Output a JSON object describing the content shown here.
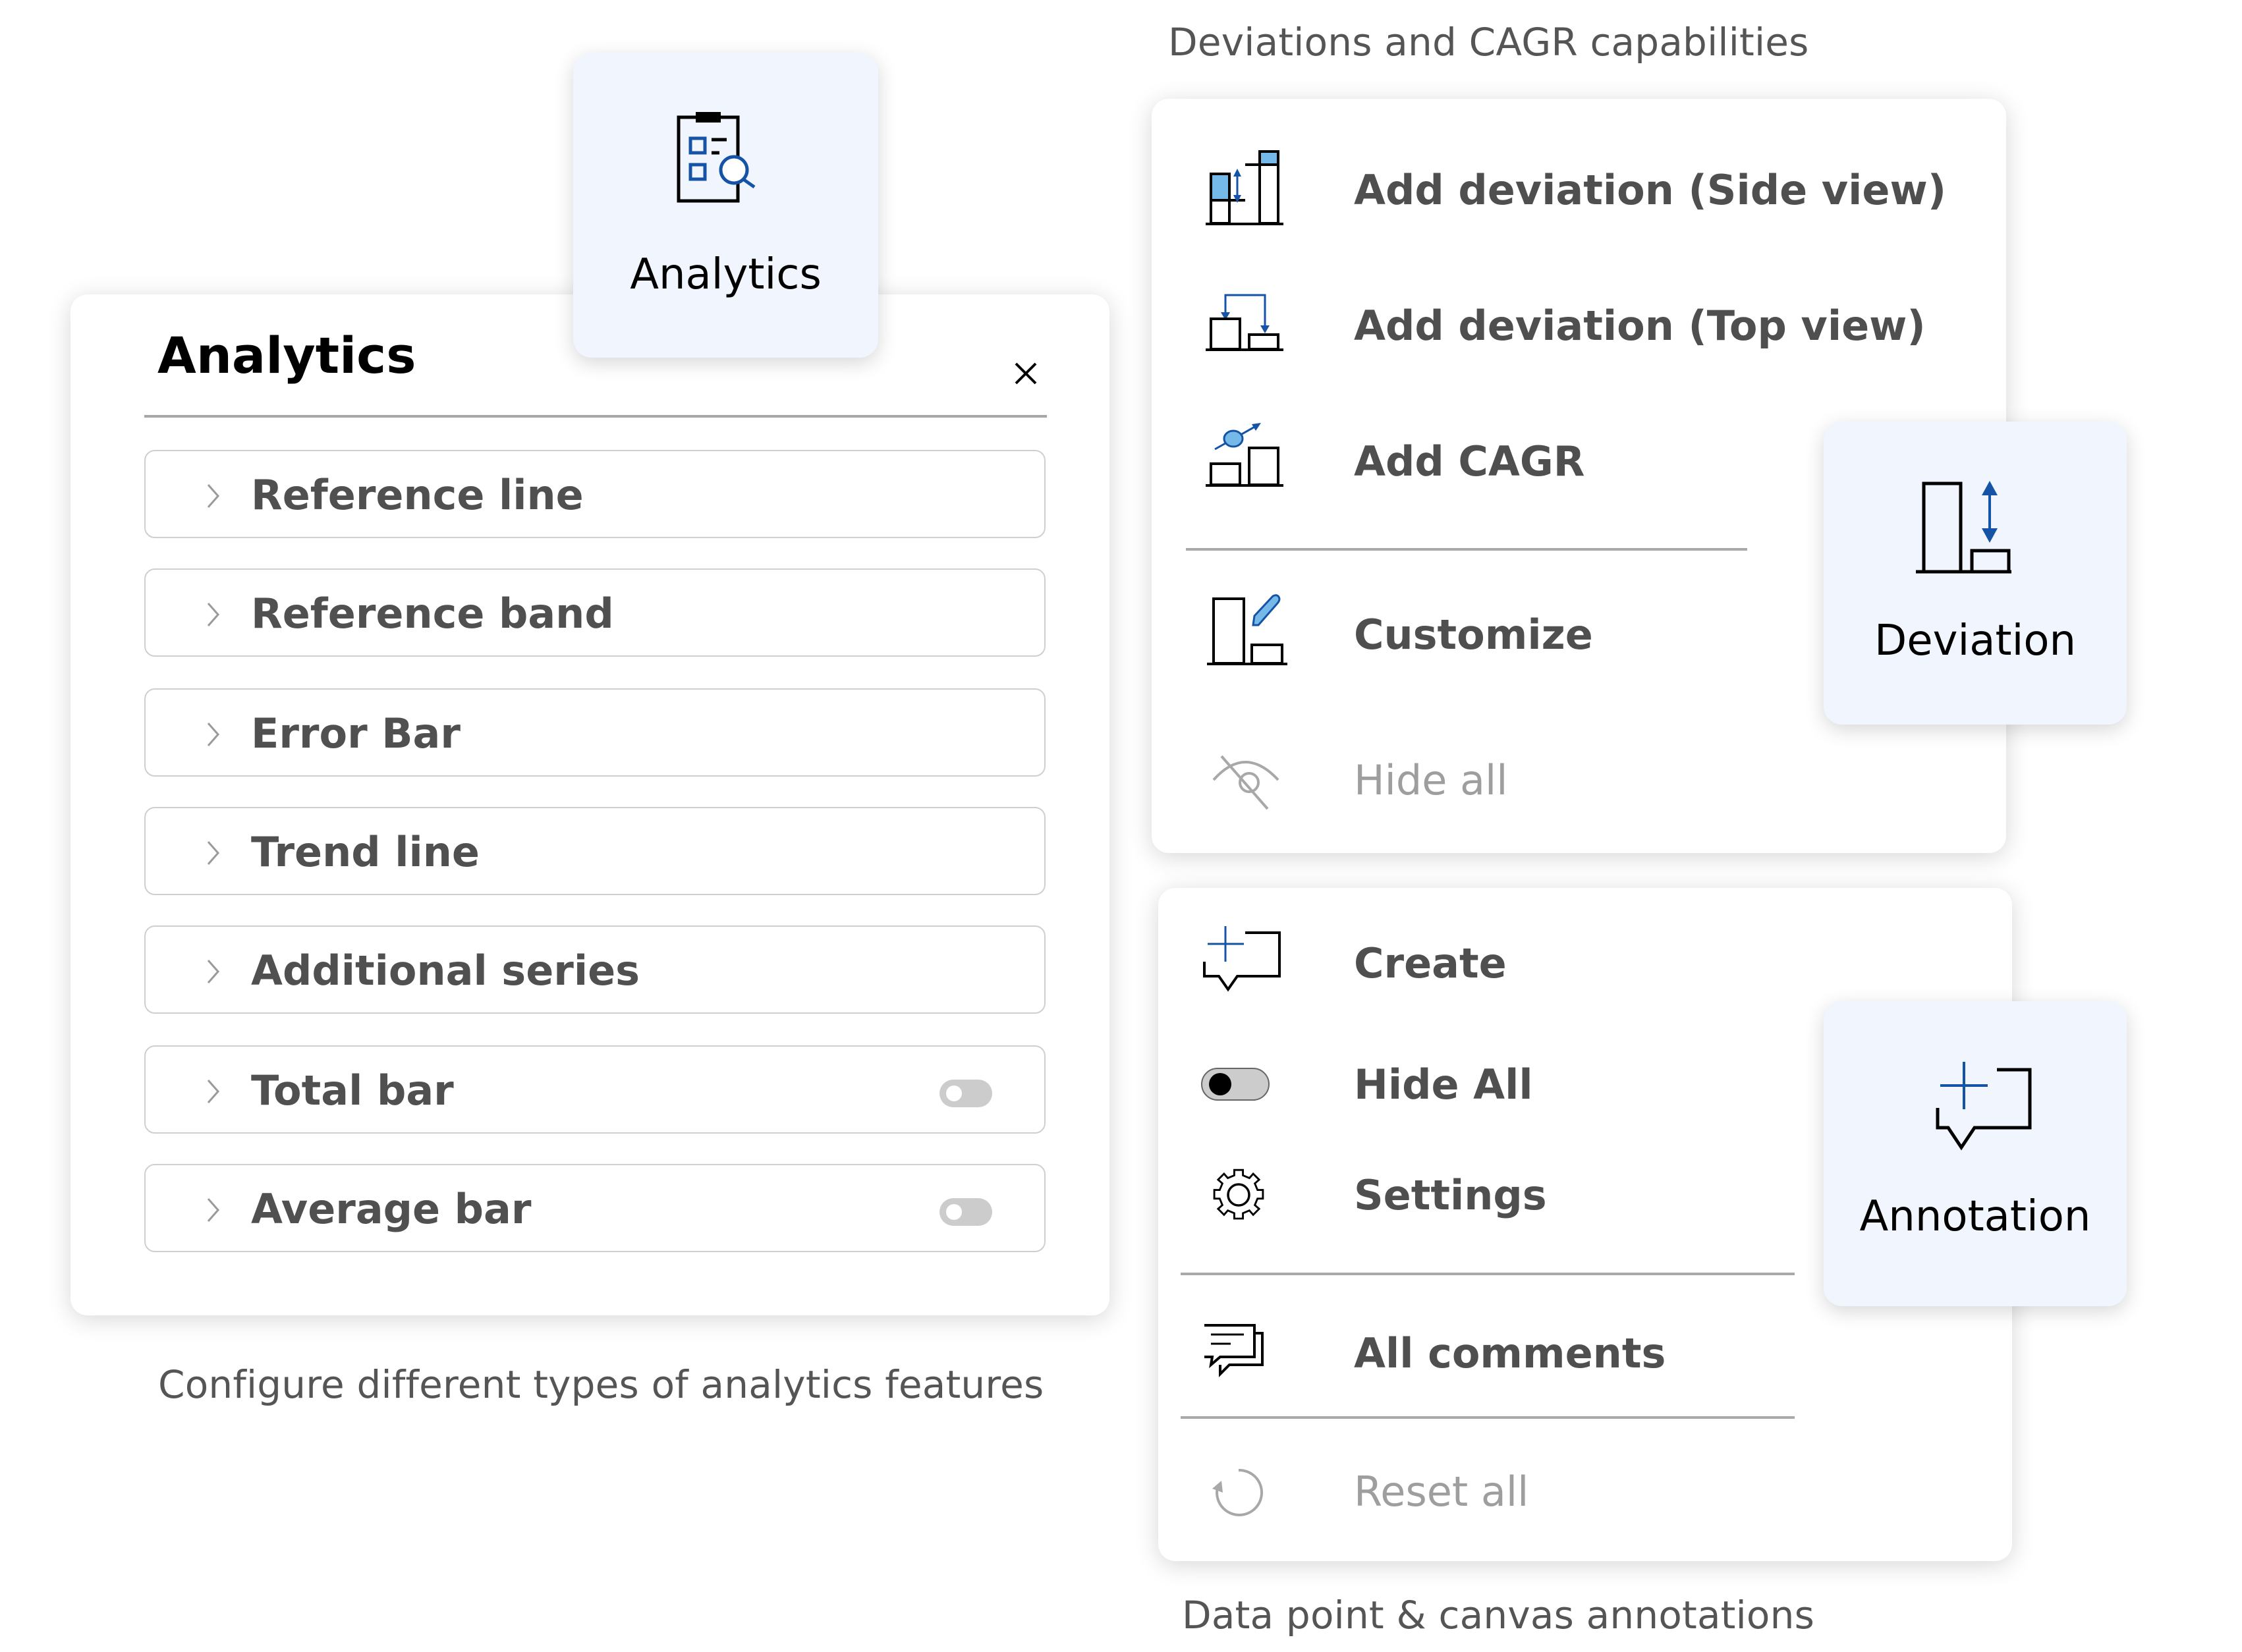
{
  "captions": {
    "deviation": "Deviations and CAGR capabilities",
    "analytics": "Configure different types of analytics features",
    "annotation": "Data point & canvas annotations"
  },
  "analytics_card": {
    "label": "Analytics",
    "icon": "clipboard-search-icon"
  },
  "analytics_panel": {
    "title": "Analytics",
    "close_icon": "close-icon",
    "items": [
      {
        "label": "Reference line",
        "has_toggle": false
      },
      {
        "label": "Reference band",
        "has_toggle": false
      },
      {
        "label": "Error Bar",
        "has_toggle": false
      },
      {
        "label": "Trend line",
        "has_toggle": false
      },
      {
        "label": "Additional series",
        "has_toggle": false
      },
      {
        "label": "Total bar",
        "has_toggle": true,
        "toggle_on": false
      },
      {
        "label": "Average bar",
        "has_toggle": true,
        "toggle_on": false
      }
    ]
  },
  "deviation_menu": {
    "items": [
      {
        "label": "Add deviation (Side view)",
        "icon": "deviation-side-view-icon",
        "disabled": false
      },
      {
        "label": "Add deviation (Top view)",
        "icon": "deviation-top-view-icon",
        "disabled": false
      },
      {
        "label": "Add CAGR",
        "icon": "cagr-icon",
        "disabled": false
      },
      {
        "label": "Customize",
        "icon": "customize-chart-icon",
        "disabled": false
      },
      {
        "label": "Hide all",
        "icon": "eye-hidden-icon",
        "disabled": true
      }
    ]
  },
  "deviation_card": {
    "label": "Deviation",
    "icon": "deviation-icon"
  },
  "annotation_menu": {
    "items": [
      {
        "label": "Create",
        "icon": "add-comment-icon",
        "disabled": false
      },
      {
        "label": "Hide All",
        "icon": "toggle-icon",
        "disabled": false,
        "toggle_on": false
      },
      {
        "label": "Settings",
        "icon": "gear-icon",
        "disabled": false
      },
      {
        "label": "All comments",
        "icon": "comments-icon",
        "disabled": false
      },
      {
        "label": "Reset all",
        "icon": "reset-icon",
        "disabled": true
      }
    ]
  },
  "annotation_card": {
    "label": "Annotation",
    "icon": "add-comment-icon"
  },
  "colors": {
    "accent_blue": "#0f4ea6",
    "light_blue": "#74b9e8",
    "card_bg": "#f1f5fe",
    "text_dark": "#4f4f4f",
    "text_disabled": "#9e9e9e"
  }
}
